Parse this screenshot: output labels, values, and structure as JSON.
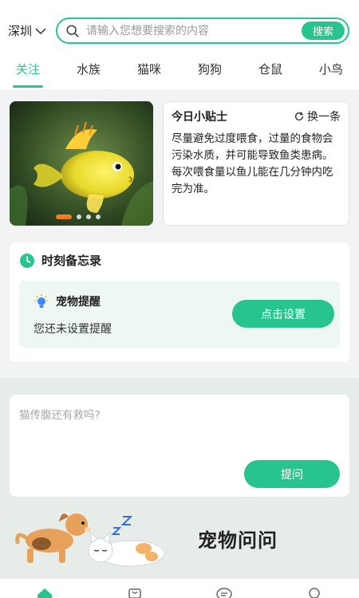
{
  "header": {
    "city": "深圳",
    "search_placeholder": "请输入您想要搜索的内容",
    "search_button": "搜索"
  },
  "tabs": [
    {
      "label": "关注",
      "active": true
    },
    {
      "label": "水族",
      "active": false
    },
    {
      "label": "猫咪",
      "active": false
    },
    {
      "label": "狗狗",
      "active": false
    },
    {
      "label": "仓鼠",
      "active": false
    },
    {
      "label": "小鸟",
      "active": false
    }
  ],
  "banner": {
    "slide_count": 4,
    "active_slide": 1
  },
  "tip": {
    "title": "今日小贴士",
    "refresh_label": "换一条",
    "text": "尽量避免过度喂食，过量的食物会污染水质，并可能导致鱼类患病。每次喂食量以鱼儿能在几分钟内吃完为准。"
  },
  "memo": {
    "title": "时刻备忘录",
    "reminder_title": "宠物提醒",
    "reminder_status": "您还未设置提醒",
    "set_button": "点击设置"
  },
  "ask": {
    "placeholder": "猫传腹还有救吗?",
    "submit_button": "提问",
    "section_title": "宠物问问"
  },
  "bottom_nav": [
    {
      "icon": "home-icon",
      "active": true
    },
    {
      "icon": "shop-bag-icon",
      "active": false
    },
    {
      "icon": "message-icon",
      "active": false
    },
    {
      "icon": "profile-icon",
      "active": false
    }
  ],
  "colors": {
    "accent": "#27c48f",
    "dot_active": "#ff7a1a",
    "memo_bg": "#eef7f2"
  }
}
